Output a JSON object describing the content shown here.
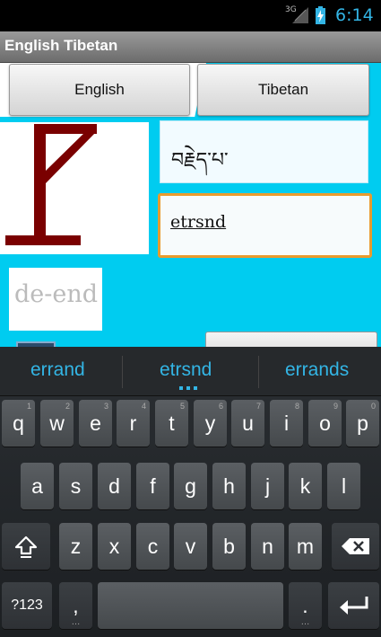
{
  "status": {
    "network": "3G",
    "time": "6:14"
  },
  "app": {
    "title": "English Tibetan"
  },
  "buttons": {
    "english": "English",
    "tibetan": "Tibetan"
  },
  "game": {
    "tibetan_word": "བརྗེད་པ་",
    "guess": "etrsnd",
    "answer": "de-end"
  },
  "colors": {
    "accent": "#33b5e5",
    "background": "#00ccf0",
    "focus_border": "#ea9b2e",
    "hangman": "#7a0000"
  },
  "keyboard": {
    "suggestions": [
      "errand",
      "etrsnd",
      "errands"
    ],
    "row1": [
      {
        "k": "q",
        "h": "1"
      },
      {
        "k": "w",
        "h": "2"
      },
      {
        "k": "e",
        "h": "3"
      },
      {
        "k": "r",
        "h": "4"
      },
      {
        "k": "t",
        "h": "5"
      },
      {
        "k": "y",
        "h": "6"
      },
      {
        "k": "u",
        "h": "7"
      },
      {
        "k": "i",
        "h": "8"
      },
      {
        "k": "o",
        "h": "9"
      },
      {
        "k": "p",
        "h": "0"
      }
    ],
    "row2": [
      "a",
      "s",
      "d",
      "f",
      "g",
      "h",
      "j",
      "k",
      "l"
    ],
    "row3": [
      "z",
      "x",
      "c",
      "v",
      "b",
      "n",
      "m"
    ],
    "symbols_label": "?123",
    "comma": ",",
    "period": ".",
    "shift_icon": "shift-icon",
    "backspace_icon": "backspace-icon",
    "enter_icon": "enter-icon"
  }
}
